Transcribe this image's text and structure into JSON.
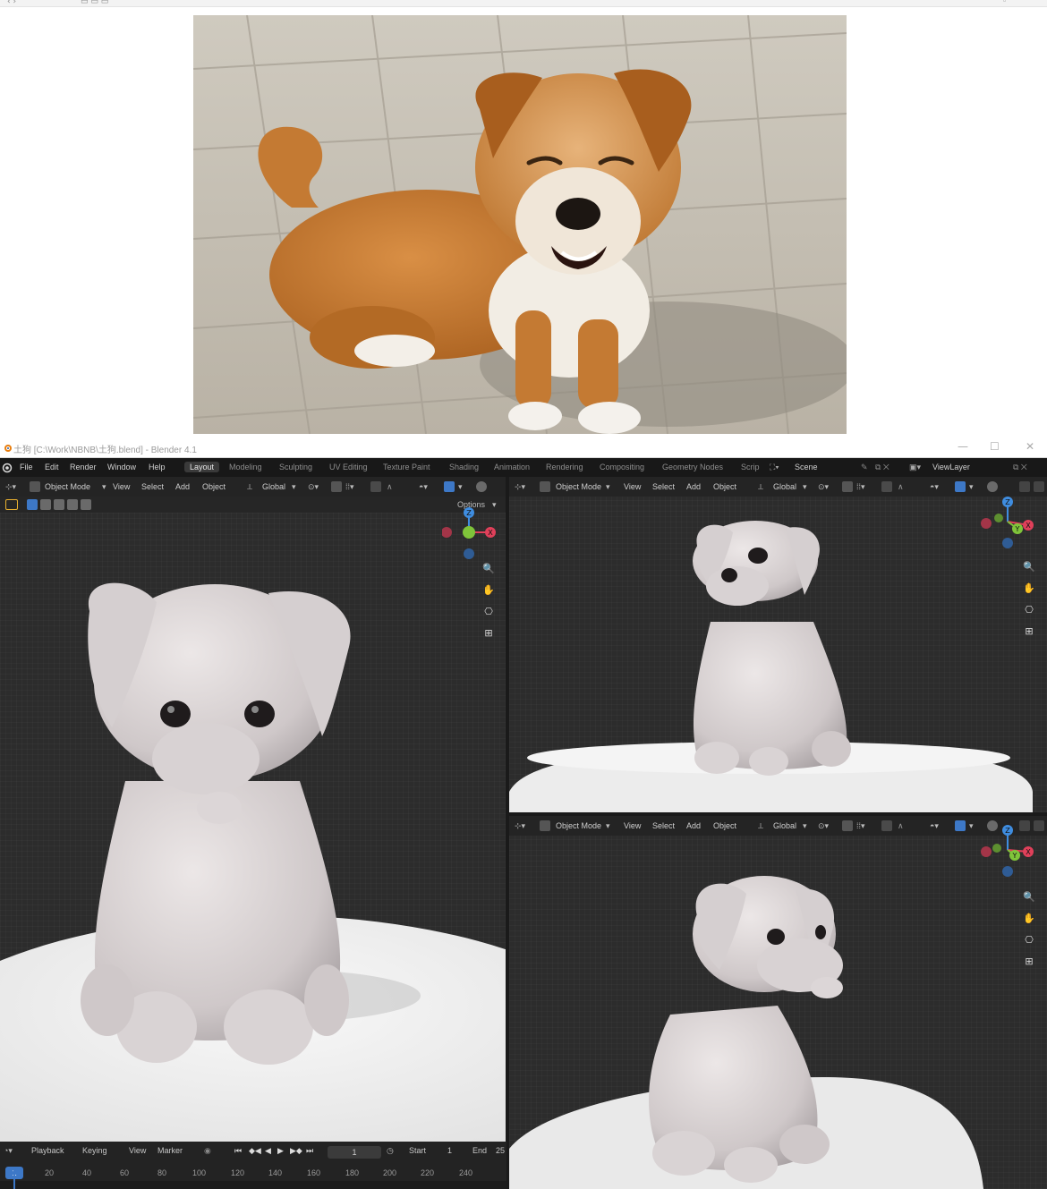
{
  "window": {
    "title": "土狗 [C:\\Work\\NBNB\\土狗.blend] - Blender 4.1",
    "controls": [
      "—",
      "☐",
      "✕"
    ]
  },
  "menu": {
    "items": [
      "File",
      "Edit",
      "Render",
      "Window",
      "Help"
    ],
    "workspaces": [
      "Layout",
      "Modeling",
      "Sculpting",
      "UV Editing",
      "Texture Paint",
      "Shading",
      "Animation",
      "Rendering",
      "Compositing",
      "Geometry Nodes",
      "Scrip"
    ],
    "active_workspace": "Layout",
    "scene": "Scene",
    "view_layer": "ViewLayer"
  },
  "viewport_header": {
    "mode": "Object Mode",
    "menus": [
      "View",
      "Select",
      "Add",
      "Object"
    ],
    "transform_orientation": "Global"
  },
  "viewport_left": {
    "options_label": "Options"
  },
  "gizmo_axes": [
    "X",
    "Y",
    "Z"
  ],
  "timeline": {
    "menus": [
      "Playback",
      "Keying",
      "View",
      "Marker"
    ],
    "current_frame": "1",
    "start_label": "Start",
    "start_value": "1",
    "end_label": "End",
    "end_value": "25",
    "ticks": [
      "20",
      "40",
      "60",
      "80",
      "100",
      "120",
      "140",
      "160",
      "180",
      "200",
      "220",
      "240"
    ],
    "playhead": "1"
  },
  "colors": {
    "axis_x": "#e0405a",
    "axis_y": "#7fc43a",
    "axis_z": "#3f8de0",
    "accent_blue": "#3d78c7",
    "viewport_bg": "#2c2c2c",
    "model_color": "#dcd6d6"
  },
  "icons": {
    "blender_logo": "blender-logo-icon",
    "zoom": "zoom-icon",
    "pan": "hand-pan-icon",
    "camera": "camera-icon",
    "grid": "ortho-grid-icon"
  }
}
